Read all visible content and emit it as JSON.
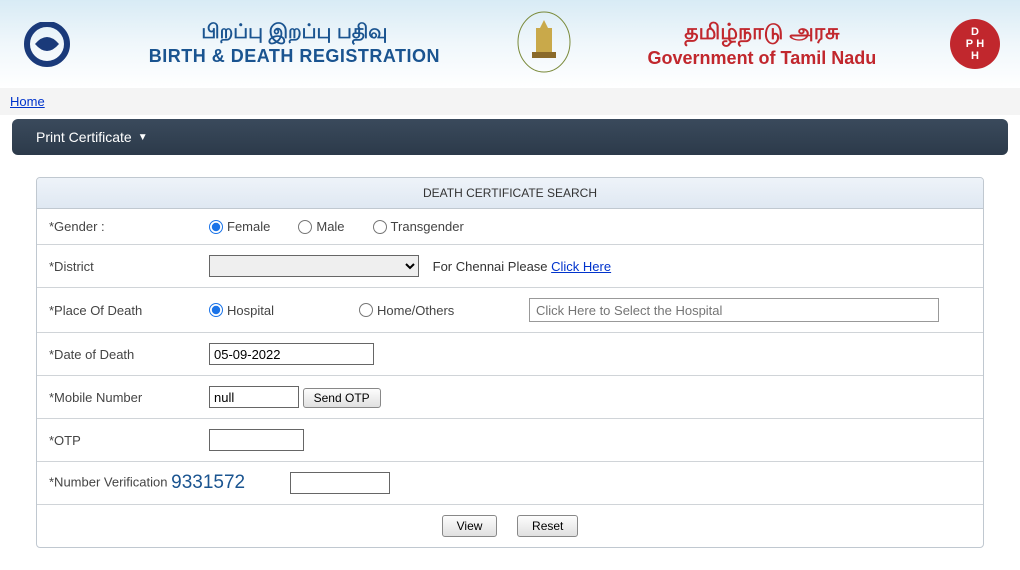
{
  "header": {
    "tamil_title": "பிறப்பு இறப்பு பதிவு",
    "eng_title": "BIRTH & DEATH REGISTRATION",
    "tamil_govt": "தமிழ்நாடு அரசு",
    "eng_govt": "Government of Tamil Nadu",
    "dph": "DPH"
  },
  "nav": {
    "home": "Home",
    "menu_print": "Print Certificate"
  },
  "panel": {
    "title": "DEATH CERTIFICATE SEARCH"
  },
  "form": {
    "gender_label": "*Gender :",
    "gender_female": "Female",
    "gender_male": "Male",
    "gender_trans": "Transgender",
    "district_label": "*District",
    "chennai_prefix": "For Chennai Please ",
    "chennai_link": "Click Here",
    "pod_label": "*Place Of Death",
    "pod_hospital": "Hospital",
    "pod_home": "Home/Others",
    "hospital_placeholder": "Click Here to Select the Hospital",
    "dod_label": "*Date of Death",
    "dod_value": "05-09-2022",
    "mobile_label": "*Mobile Number",
    "mobile_value": "null",
    "send_otp": "Send OTP",
    "otp_label": "*OTP",
    "verify_label": "*Number Verification",
    "verify_code": "9331572",
    "view_btn": "View",
    "reset_btn": "Reset"
  }
}
